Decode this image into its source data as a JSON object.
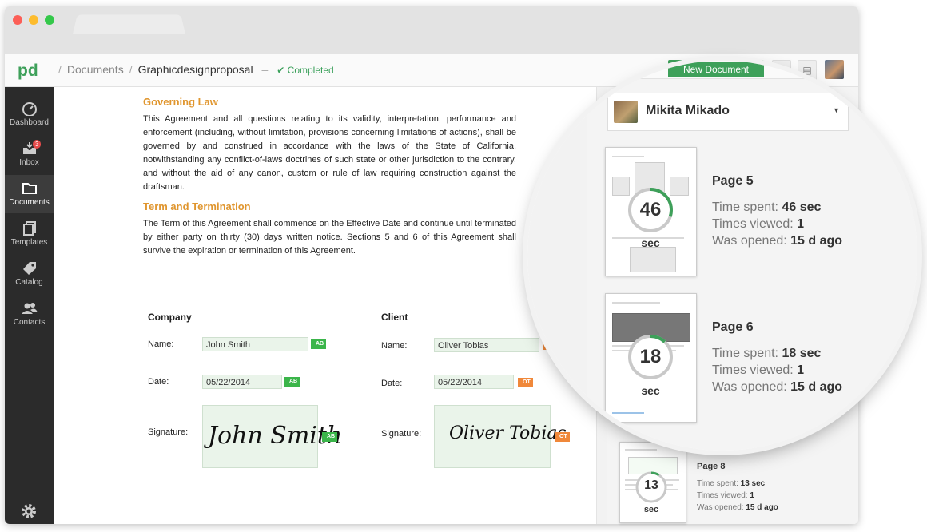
{
  "breadcrumb": {
    "section": "Documents",
    "document": "Graphicdesignproposal",
    "dash": "–",
    "status": "Completed"
  },
  "toolbar": {
    "new_document": "New Document"
  },
  "sidebar": {
    "items": [
      {
        "label": "Dashboard",
        "icon": "dashboard-icon"
      },
      {
        "label": "Inbox",
        "icon": "inbox-icon",
        "badge": "3"
      },
      {
        "label": "Documents",
        "icon": "folder-icon",
        "active": true
      },
      {
        "label": "Templates",
        "icon": "templates-icon"
      },
      {
        "label": "Catalog",
        "icon": "tag-icon"
      },
      {
        "label": "Contacts",
        "icon": "contacts-icon"
      }
    ],
    "settings_icon": "gear-icon"
  },
  "document": {
    "governing_law": {
      "title": "Governing Law",
      "text": "This Agreement and all questions relating to its validity, interpretation, performance and enforcement (including, without limitation, provisions concerning limitations of actions), shall be governed by and construed in accordance with the laws of the State of California, notwithstanding any conflict-of-laws doctrines of such state or other jurisdiction to the contrary, and without the aid of any canon, custom or rule of law requiring construction against the draftsman."
    },
    "term": {
      "title": "Term and Termination",
      "text": "The Term of this Agreement shall commence on the Effective Date and continue until terminated by either party on thirty (30) days written notice. Sections 5 and 6 of this Agreement shall survive the expiration or termination of this Agreement."
    },
    "company": {
      "heading": "Company",
      "name_label": "Name:",
      "name": "John Smith",
      "date_label": "Date:",
      "date": "05/22/2014",
      "signature_label": "Signature:",
      "signature": "John Smith",
      "tag": "AB"
    },
    "client": {
      "heading": "Client",
      "name_label": "Name:",
      "name": "Oliver Tobias",
      "date_label": "Date:",
      "date": "05/22/2014",
      "signature_label": "Signature:",
      "signature": "Oliver Tobias",
      "tag": "OT"
    }
  },
  "analytics": {
    "user": "Mikita Mikado",
    "pages": [
      {
        "title": "Page 5",
        "seconds": "46",
        "unit": "sec",
        "progress": 0.3,
        "time_label": "Time spent:",
        "time": "46 sec",
        "views_label": "Times viewed:",
        "views": "1",
        "opened_label": "Was opened:",
        "opened": "15 d ago"
      },
      {
        "title": "Page 6",
        "seconds": "18",
        "unit": "sec",
        "progress": 0.12,
        "time_label": "Time spent:",
        "time": "18 sec",
        "views_label": "Times viewed:",
        "views": "1",
        "opened_label": "Was opened:",
        "opened": "15 d ago"
      },
      {
        "title": "Page 8",
        "seconds": "13",
        "unit": "sec",
        "progress": 0.09,
        "time_label": "Time spent:",
        "time": "13 sec",
        "views_label": "Times viewed:",
        "views": "1",
        "opened_label": "Was opened:",
        "opened": "15 d ago"
      }
    ]
  },
  "colors": {
    "accent": "#3ea05a",
    "heading": "#e0962f",
    "tag_ab": "#3bb54a",
    "tag_ot": "#f0883a",
    "sidebar": "#2b2b2b"
  }
}
